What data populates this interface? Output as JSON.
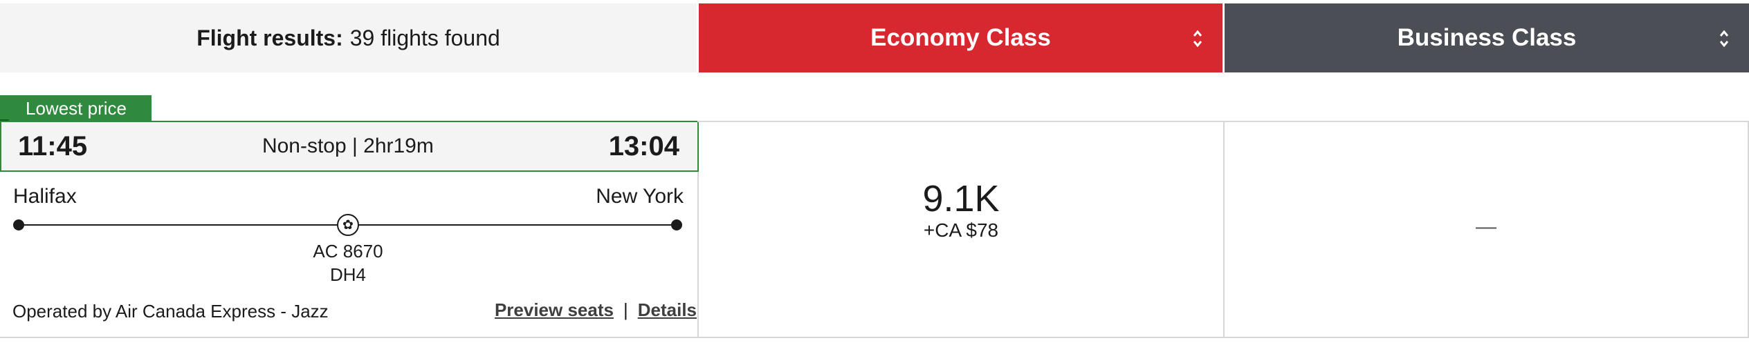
{
  "header": {
    "results_label": "Flight results:",
    "results_count": "39 flights found",
    "cabins": [
      {
        "label": "Economy Class",
        "color": "#d8282f",
        "sort_icon": "sort-icon"
      },
      {
        "label": "Business Class",
        "color": "#4b4e54",
        "sort_icon": "sort-icon"
      }
    ]
  },
  "tag": {
    "label": "Lowest price",
    "color": "#2f8a3e"
  },
  "flight": {
    "depart_time": "11:45",
    "arrive_time": "13:04",
    "duration": "Non-stop | 2hr19m",
    "origin": "Halifax",
    "destination": "New York",
    "airline_icon": "maple-leaf-icon",
    "flight_number": "AC 8670",
    "aircraft": "DH4",
    "operated_by": "Operated by Air Canada Express - Jazz",
    "links": {
      "preview_seats": "Preview seats",
      "separator": "|",
      "details": "Details"
    }
  },
  "fares": {
    "economy": {
      "points": "9.1K",
      "cash": "+CA $78"
    },
    "business": {
      "unavailable": "—"
    }
  }
}
